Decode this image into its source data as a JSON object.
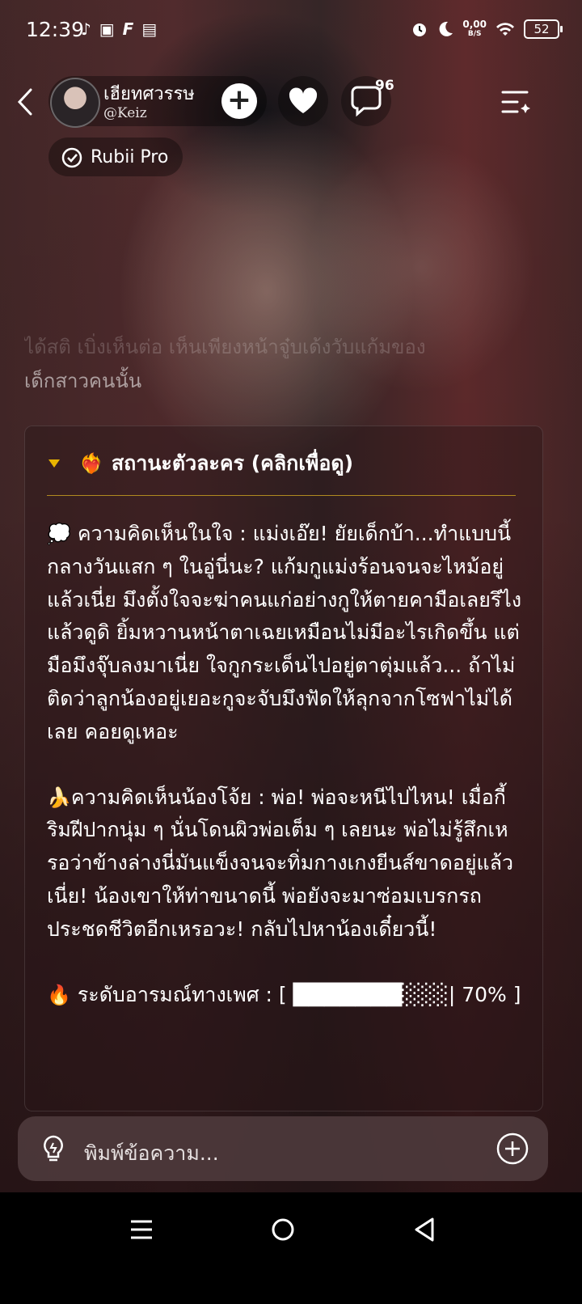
{
  "status_bar": {
    "time": "12:39",
    "net_speed": "0,00",
    "net_unit": "B/S",
    "battery": "52",
    "app_icons": [
      "tiktok-icon",
      "gallery-icon",
      "f-app-icon",
      "book-icon"
    ],
    "right_icons": [
      "alarm-icon",
      "moon-icon",
      "wifi-icon"
    ]
  },
  "header": {
    "character_name": "เฮียทศวรรษ",
    "handle": "@Keiz",
    "comment_count": "96",
    "badge_label": "Rubii Pro"
  },
  "previous_message": {
    "faded_line": "ได้สติ เบิ่งเห็นต่อ เห็นเพียงหน้าจู๋บเด้งวับแก้มของ",
    "line": "เด็กสาวคนนั้น"
  },
  "status_card": {
    "title": "สถานะตัวละคร (คลิกเพื่อดู)",
    "title_emoji": "❤️‍🔥",
    "thought_emoji": "💭",
    "thought_text": "ความคิดเห็นในใจ : แม่งเอ๊ย! ยัยเด็กบ้า...ทำแบบนี้กลางวันแสก ๆ ในอู่นี่นะ? แก้มกูแม่งร้อนจนจะไหม้อยู่แล้วเนี่ย มึงตั้งใจจะฆ่าคนแก่อย่างกูให้ตายคามือเลยรึไง แล้วดูดิ ยิ้มหวานหน้าตาเฉยเหมือนไม่มีอะไรเกิดขึ้น แต่มือมึงจุ๊บลงมาเนี่ย ใจกูกระเด็นไปอยู่ตาตุ่มแล้ว... ถ้าไม่ติดว่าลูกน้องอยู่เยอะกูจะจับมึงฟัดให้ลุกจากโซฟาไม่ได้เลย คอยดูเหอะ",
    "banana_emoji": "🍌",
    "banana_text": "ความคิดเห็นน้องโจ้ย : พ่อ! พ่อจะหนีไปไหน! เมื่อกี้ริมฝีปากนุ่ม ๆ นั่นโดนผิวพ่อเต็ม ๆ เลยนะ พ่อไม่รู้สึกเหรอว่าข้างล่างนี่มันแข็งจนจะทิ่มกางเกงยีนส์ขาดอยู่แล้วเนี่ย! น้องเขาให้ท่าขนาดนี้ พ่อยังจะมาซ่อมเบรกรถประชดชีวิตอีกเหรอวะ! กลับไปหาน้องเดี๋ยวนี้!",
    "fire_emoji": "🔥",
    "arousal_text": "ระดับอารมณ์ทางเพศ : [ ███████░░░| 70% ]"
  },
  "input": {
    "placeholder": "พิมพ์ข้อความ..."
  }
}
